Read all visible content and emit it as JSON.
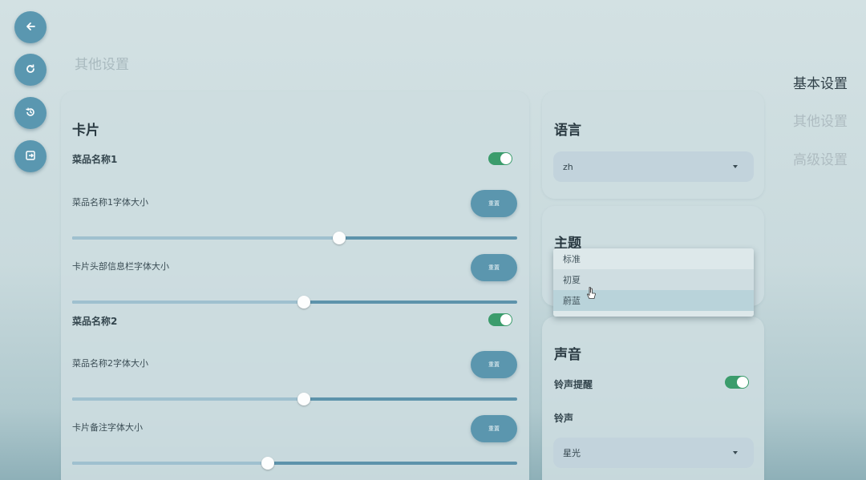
{
  "page_title": "其他设置",
  "left_toolbar": [
    {
      "icon": "arrow-left-icon"
    },
    {
      "icon": "refresh-icon"
    },
    {
      "icon": "history-icon"
    },
    {
      "icon": "exit-icon"
    }
  ],
  "card_section": {
    "title": "卡片",
    "rows": [
      {
        "label": "菜品名称1",
        "toggle_on": true
      },
      {
        "label": "菜品名称1字体大小",
        "reset_label": "重置",
        "value_fraction": 0.6
      },
      {
        "label": "卡片头部信息栏字体大小",
        "reset_label": "重置",
        "value_fraction": 0.52
      },
      {
        "label": "菜品名称2",
        "toggle_on": true
      },
      {
        "label": "菜品名称2字体大小",
        "reset_label": "重置",
        "value_fraction": 0.52
      },
      {
        "label": "卡片备注字体大小",
        "reset_label": "重置",
        "value_fraction": 0.44
      }
    ]
  },
  "language": {
    "title": "语言",
    "value": "zh"
  },
  "theme": {
    "title": "主题",
    "options": [
      "标准",
      "初夏",
      "蔚蓝"
    ],
    "hovered_option": "初夏",
    "selected_option": "蔚蓝"
  },
  "sound": {
    "title": "声音",
    "ringtone_alert_label": "铃声提醒",
    "ringtone_alert_on": true,
    "ringtone_label": "铃声",
    "ringtone_value": "星光"
  },
  "right_nav": [
    {
      "label": "基本设置",
      "active": true
    },
    {
      "label": "其他设置",
      "active": false
    },
    {
      "label": "高级设置",
      "active": false
    }
  ],
  "colors": {
    "accent": "#5a97b0",
    "toggle_on": "#3b9c6c",
    "nav_active": "#2f3f47",
    "nav_inactive": "#aebcc1"
  }
}
